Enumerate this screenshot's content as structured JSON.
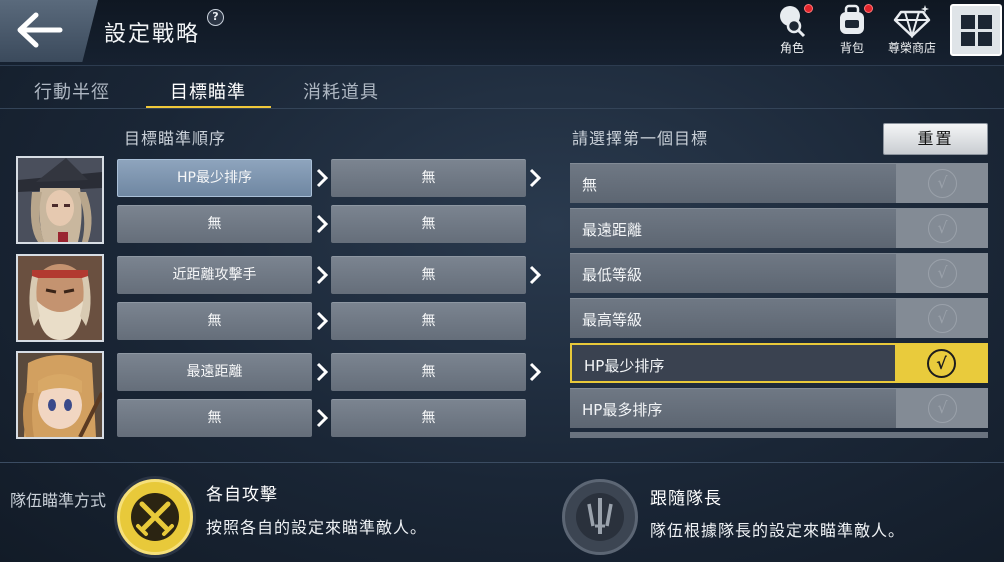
{
  "header": {
    "title": "設定戰略",
    "help_symbol": "?",
    "buttons": [
      {
        "label": "角色",
        "icon": "character-icon",
        "has_notification": true
      },
      {
        "label": "背包",
        "icon": "backpack-icon",
        "has_notification": true
      },
      {
        "label": "尊榮商店",
        "icon": "diamond-shop-icon",
        "has_notification": false
      }
    ],
    "menu_icon": "grid-menu-icon"
  },
  "tabs": [
    {
      "label": "行動半徑",
      "active": false
    },
    {
      "label": "目標瞄準",
      "active": true
    },
    {
      "label": "消耗道具",
      "active": false
    }
  ],
  "left_panel": {
    "title": "目標瞄準順序",
    "characters": [
      {
        "name": "witch-hero",
        "rows": [
          [
            "HP最少排序",
            "無"
          ],
          [
            "無",
            "無"
          ]
        ]
      },
      {
        "name": "elder-hero",
        "rows": [
          [
            "近距離攻擊手",
            "無"
          ],
          [
            "無",
            "無"
          ]
        ]
      },
      {
        "name": "blonde-hero",
        "rows": [
          [
            "最遠距離",
            "無"
          ],
          [
            "無",
            "無"
          ]
        ]
      }
    ]
  },
  "right_panel": {
    "title": "請選擇第一個目標",
    "reset_label": "重置",
    "check_symbol": "√",
    "options": [
      {
        "label": "無",
        "selected": false
      },
      {
        "label": "最遠距離",
        "selected": false
      },
      {
        "label": "最低等級",
        "selected": false
      },
      {
        "label": "最高等級",
        "selected": false
      },
      {
        "label": "HP最少排序",
        "selected": true
      },
      {
        "label": "HP最多排序",
        "selected": false
      }
    ]
  },
  "team_targeting": {
    "label": "隊伍瞄準方式",
    "modes": [
      {
        "title": "各自攻擊",
        "desc": "按照各自的設定來瞄準敵人。",
        "icon": "crossed-swords-icon",
        "active": true
      },
      {
        "title": "跟隨隊長",
        "desc": "隊伍根據隊長的設定來瞄準敵人。",
        "icon": "trident-icon",
        "active": false
      }
    ]
  },
  "colors": {
    "accent": "#e9cb3c",
    "selected_slot": "#7f96b0",
    "slot": "#707985"
  }
}
